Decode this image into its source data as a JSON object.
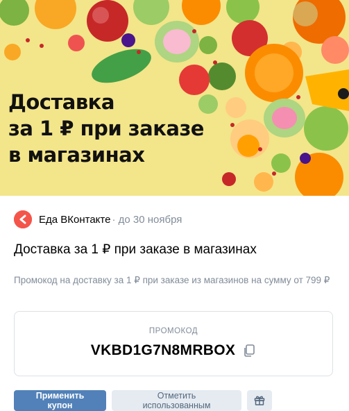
{
  "banner": {
    "title_lines": [
      "Доставка",
      "за 1 ₽ при заказе",
      "в магазинах"
    ]
  },
  "source": {
    "name": "Еда ВКонтакте",
    "date": "· до 30 ноября",
    "logo_icon": "vk-food-logo-icon",
    "logo_color": "#f4554a"
  },
  "offer": {
    "title": "Доставка за 1 ₽ при заказе в магазинах",
    "description": "Промокод на доставку за 1 ₽ при заказе из магазинов на сумму от 799 ₽"
  },
  "promo": {
    "label": "ПРОМОКОД",
    "code": "VKBD1G7N8MRBOX",
    "copy_icon": "copy-icon"
  },
  "actions": {
    "apply_label": "Применить купон",
    "mark_used_label": "Отметить использованным",
    "gift_icon": "gift-icon"
  },
  "colors": {
    "primary": "#5181b8",
    "secondary_bg": "#e5ebf1",
    "muted_text": "#818c99",
    "banner_bg": "#f3e58a"
  }
}
